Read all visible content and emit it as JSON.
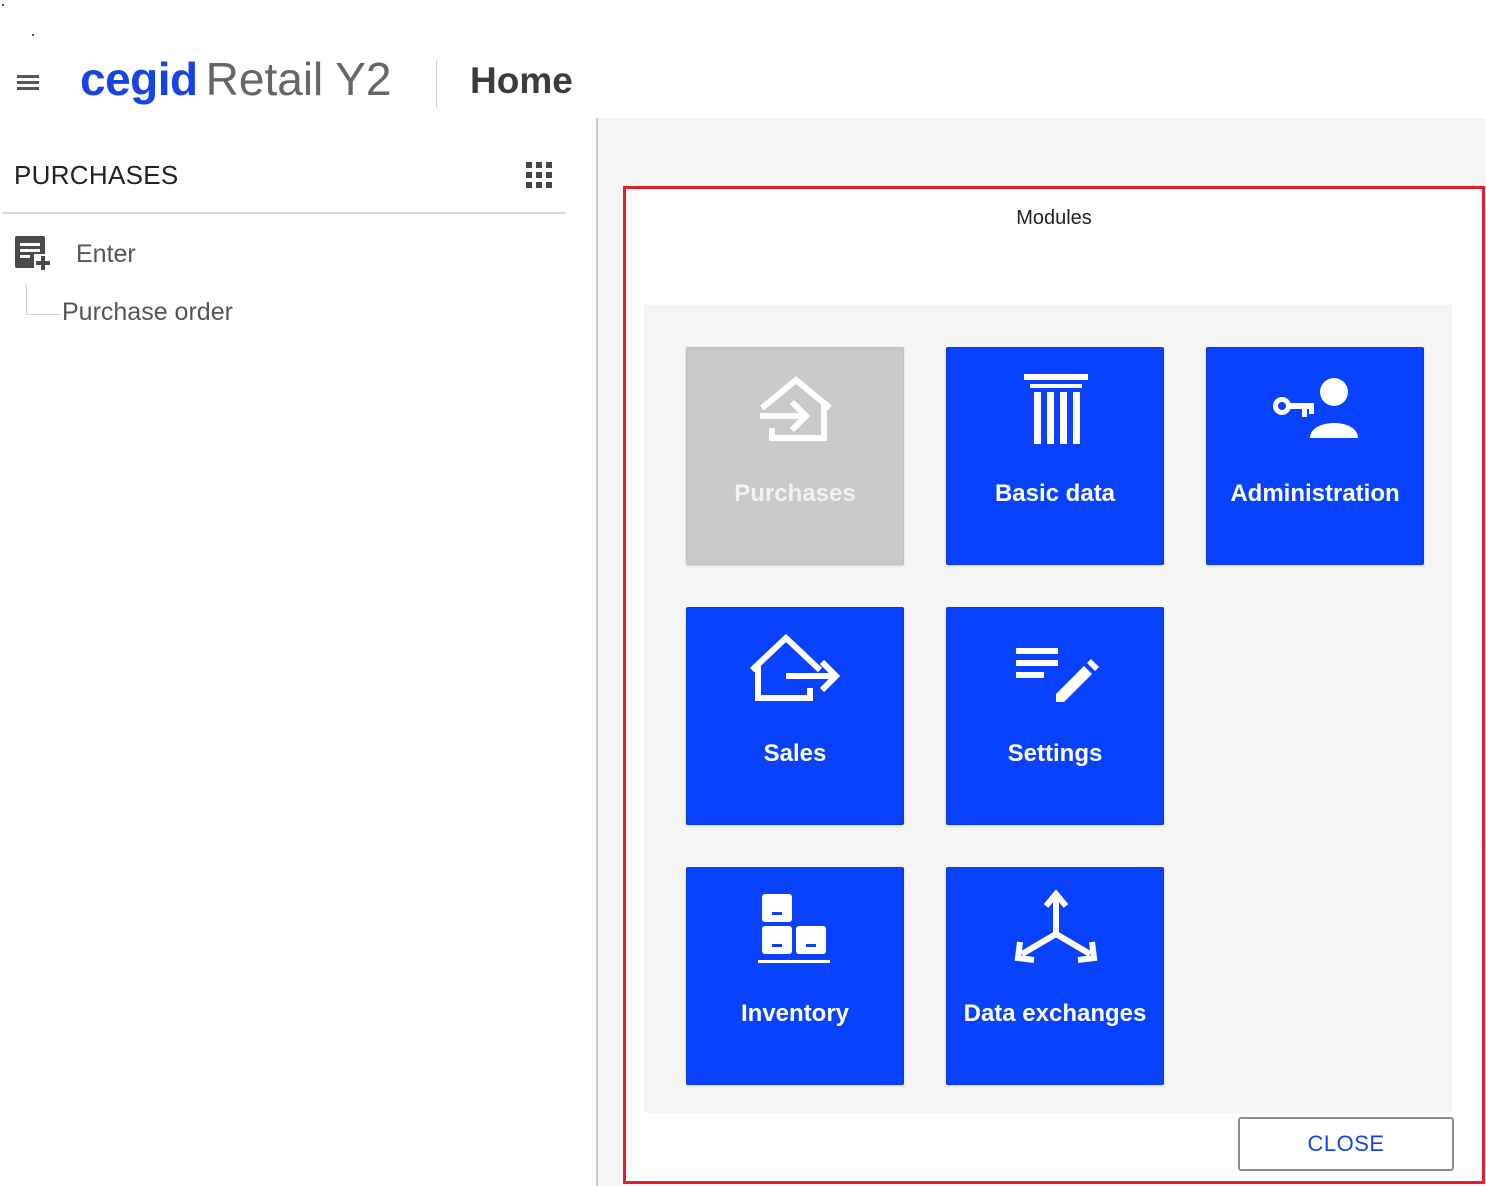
{
  "header": {
    "brand_company": "cegid",
    "brand_product": "Retail Y2",
    "page_title": "Home"
  },
  "sidebar": {
    "module_title": "PURCHASES",
    "group": {
      "label": "Enter",
      "icon": "add-document-icon"
    },
    "items": [
      {
        "label": "Purchase order"
      }
    ]
  },
  "dialog": {
    "title": "Modules",
    "tiles": [
      {
        "label": "Purchases",
        "icon": "purchases-inbound-house-icon",
        "enabled": false
      },
      {
        "label": "Basic data",
        "icon": "column-pillar-icon",
        "enabled": true
      },
      {
        "label": "Administration",
        "icon": "key-user-icon",
        "enabled": true
      },
      {
        "label": "Sales",
        "icon": "sales-outbound-house-icon",
        "enabled": true
      },
      {
        "label": "Settings",
        "icon": "list-edit-icon",
        "enabled": true
      },
      {
        "label": "Inventory",
        "icon": "stacked-boxes-icon",
        "enabled": true
      },
      {
        "label": "Data exchanges",
        "icon": "three-way-arrows-icon",
        "enabled": true
      }
    ],
    "close_label": "CLOSE"
  },
  "colors": {
    "brand_blue": "#1744e6",
    "tile_blue": "#0842ff",
    "tile_disabled": "#c9c9c9",
    "highlight_red": "#e0202a"
  }
}
